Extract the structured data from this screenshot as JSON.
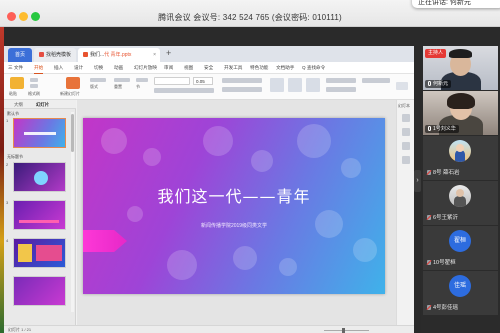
{
  "meeting": {
    "title": "腾讯会议  会议号: 342 524 765  (会议密码: 010111)",
    "corner_notice": "正在讲话: 何新元"
  },
  "wps": {
    "tabs": {
      "home": "首页",
      "template": "找稻壳模板",
      "doc_prefix": "我们...",
      "doc_file": "代 青年.pptx",
      "close": "×",
      "new_tab": "+"
    },
    "menu": [
      "三 文件",
      "开始",
      "插入",
      "设计",
      "切换",
      "动画",
      "幻灯片放映",
      "审阅",
      "视图",
      "安全",
      "开发工具",
      "特色功能",
      "文档助手",
      "Q 查找命令"
    ],
    "menu_active_index": 1,
    "ribbon": {
      "labels": [
        "粘贴",
        "格式刷",
        "新建幻灯片",
        "版式",
        "重置",
        "节"
      ],
      "font_size": "0.05"
    },
    "left_panel": {
      "tabs": [
        "大纲",
        "幻灯片"
      ],
      "sections": [
        "默认节",
        "无标题节"
      ],
      "slide_numbers": [
        "1",
        "2",
        "3",
        "4"
      ]
    },
    "slide": {
      "title": "我们这一代——青年",
      "subtitle": "新闻传播学院2019级同类文学"
    },
    "right_bar": {
      "label": "幻灯本"
    },
    "status": {
      "left": "幻灯片 1 / 21",
      "right": ""
    }
  },
  "participants": {
    "toggle": "›",
    "host_badge": "主持人",
    "video_tiles": [
      {
        "name": "何新元"
      },
      {
        "name": "1号刘义华"
      }
    ],
    "members": [
      {
        "name": "8号 薛石岩",
        "avatar": ""
      },
      {
        "name": "6号王紫沂",
        "avatar": ""
      },
      {
        "name": "10号翟桓",
        "avatar": "翟桓"
      },
      {
        "name": "4号彭佳瑶",
        "avatar": "佳瑶"
      }
    ]
  }
}
